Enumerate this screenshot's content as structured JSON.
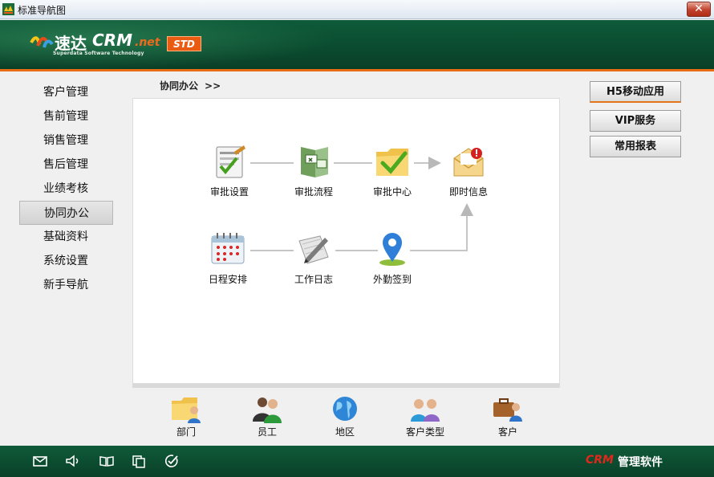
{
  "window": {
    "title": "标准导航图",
    "close_glyph": "✕"
  },
  "brand": {
    "logo_cn": "速达",
    "logo_crm": "CRM",
    "logo_net": ".net",
    "logo_en": "Superdata Software Technology",
    "edition": "STD"
  },
  "nav": {
    "items": [
      "客户管理",
      "售前管理",
      "销售管理",
      "售后管理",
      "业绩考核",
      "协同办公",
      "基础资料",
      "系统设置",
      "新手导航"
    ],
    "active": "协同办公"
  },
  "breadcrumb": {
    "current": "协同办公",
    "separator": ">>"
  },
  "flow": {
    "nodes": [
      {
        "label": "审批设置",
        "icon": "approval-settings-icon"
      },
      {
        "label": "审批流程",
        "icon": "approval-flow-icon"
      },
      {
        "label": "审批中心",
        "icon": "approval-center-folder-icon"
      },
      {
        "label": "即时信息",
        "icon": "instant-message-envelope-icon"
      },
      {
        "label": "日程安排",
        "icon": "calendar-icon"
      },
      {
        "label": "工作日志",
        "icon": "work-log-pen-icon"
      },
      {
        "label": "外勤签到",
        "icon": "location-pin-icon"
      }
    ]
  },
  "bottom": {
    "items": [
      {
        "label": "部门",
        "icon": "department-folder-icon"
      },
      {
        "label": "员工",
        "icon": "employees-icon"
      },
      {
        "label": "地区",
        "icon": "globe-icon"
      },
      {
        "label": "客户类型",
        "icon": "customer-types-icon"
      },
      {
        "label": "客户",
        "icon": "customer-briefcase-icon"
      }
    ]
  },
  "right_buttons": [
    "H5移动应用",
    "VIP服务",
    "常用报表"
  ],
  "footer": {
    "icons": [
      "mail-icon",
      "speaker-icon",
      "book-icon",
      "copy-icon",
      "check-circle-icon"
    ],
    "brand_crm": "CRM",
    "brand_rest": "管理软件"
  },
  "colors": {
    "header_green": "#0a4a2e",
    "accent_orange": "#ea6d16",
    "footer_red": "#e3271b"
  }
}
